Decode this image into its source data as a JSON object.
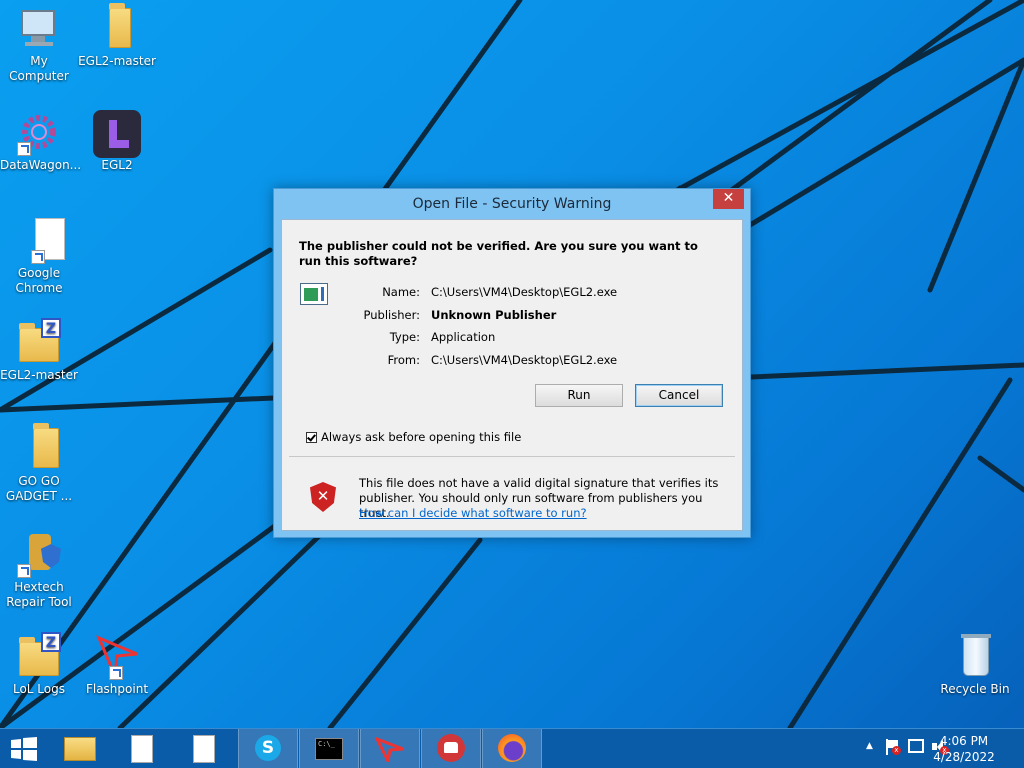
{
  "desktop": {
    "icons": [
      {
        "label": "My Computer"
      },
      {
        "label": "EGL2-master"
      },
      {
        "label": "DataWagon..."
      },
      {
        "label": "EGL2"
      },
      {
        "label": "Google Chrome"
      },
      {
        "label": "EGL2-master"
      },
      {
        "label": "GO GO GADGET ..."
      },
      {
        "label": "Hextech Repair Tool"
      },
      {
        "label": "LoL Logs"
      },
      {
        "label": "Flashpoint"
      },
      {
        "label": "Recycle Bin"
      }
    ]
  },
  "dialog": {
    "title": "Open File - Security Warning",
    "close_label": "✕",
    "headline": "The publisher could not be verified.  Are you sure you want to run this software?",
    "props": [
      {
        "key": "Name:",
        "value": "C:\\Users\\VM4\\Desktop\\EGL2.exe"
      },
      {
        "key": "Publisher:",
        "value": "Unknown Publisher"
      },
      {
        "key": "Type:",
        "value": "Application"
      },
      {
        "key": "From:",
        "value": "C:\\Users\\VM4\\Desktop\\EGL2.exe"
      }
    ],
    "run_label": "Run",
    "cancel_label": "Cancel",
    "checkbox_label": "Always ask before opening this file",
    "checkbox_checked": true,
    "warning_text": "This file does not have a valid digital signature that verifies its publisher.  You should only run software from publishers you trust.",
    "warning_link": "How can I decide what software to run?"
  },
  "taskbar": {
    "items": [
      {
        "icon": "windows-start-icon"
      },
      {
        "icon": "file-explorer-icon"
      },
      {
        "icon": "document-icon"
      },
      {
        "icon": "document-icon"
      },
      {
        "icon": "skype-icon"
      },
      {
        "icon": "command-prompt-icon"
      },
      {
        "icon": "flashpoint-icon"
      },
      {
        "icon": "riot-client-icon"
      },
      {
        "icon": "firefox-icon"
      }
    ],
    "clock_time": "4:06 PM",
    "clock_date": "4/28/2022"
  }
}
